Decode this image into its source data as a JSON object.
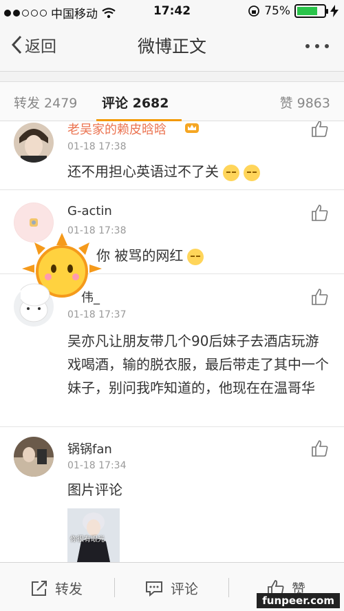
{
  "status_bar": {
    "carrier": "中国移动",
    "time": "17:42",
    "battery": "75%",
    "battery_level": 0.75
  },
  "nav": {
    "back_label": "返回",
    "title": "微博正文"
  },
  "tabs": [
    {
      "label": "转发 2479"
    },
    {
      "label": "评论 2682"
    },
    {
      "label": "赞 9863"
    }
  ],
  "comments": [
    {
      "user": "老吴家的赖皮晗晗",
      "time": "01-18 17:38",
      "text": "还不用担心英语过不了关"
    },
    {
      "user": "G-actin",
      "time": "01-18 17:38",
      "text": "你   被骂的网红"
    },
    {
      "user": "伟_",
      "time": "01-18 17:37",
      "text": "吴亦凡让朋友带几个90后妹子去酒店玩游戏喝酒，输的脱衣服，最后带走了其中一个妹子，别问我咋知道的，他现在在温哥华"
    },
    {
      "user": "锅锅fan",
      "time": "01-18 17:34",
      "text": "图片评论",
      "image_caption": "你很有眼光"
    }
  ],
  "bottom_bar": {
    "repost": "转发",
    "comment": "评论",
    "like": "赞"
  },
  "watermark": "funpeer.com",
  "colors": {
    "accent": "#f39800",
    "link_orange": "#eb7350",
    "battery_green": "#29c44a"
  }
}
